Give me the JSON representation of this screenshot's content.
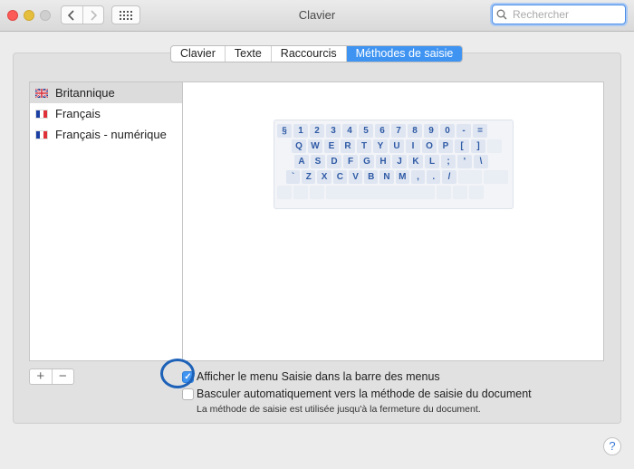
{
  "window": {
    "title": "Clavier",
    "search_placeholder": "Rechercher"
  },
  "tabs": [
    {
      "label": "Clavier",
      "active": false
    },
    {
      "label": "Texte",
      "active": false
    },
    {
      "label": "Raccourcis",
      "active": false
    },
    {
      "label": "Méthodes de saisie",
      "active": true
    }
  ],
  "input_sources": [
    {
      "label": "Britannique",
      "flag": "gb-flag-icon",
      "selected": true
    },
    {
      "label": "Français",
      "flag": "fr-flag-icon",
      "selected": false
    },
    {
      "label": "Français - numérique",
      "flag": "fr-flag-icon",
      "selected": false
    }
  ],
  "keyboard": {
    "rows": [
      [
        "§",
        "1",
        "2",
        "3",
        "4",
        "5",
        "6",
        "7",
        "8",
        "9",
        "0",
        "-",
        "="
      ],
      [
        "Q",
        "W",
        "E",
        "R",
        "T",
        "Y",
        "U",
        "I",
        "O",
        "P",
        "[",
        "]"
      ],
      [
        "A",
        "S",
        "D",
        "F",
        "G",
        "H",
        "J",
        "K",
        "L",
        ";",
        "'",
        "\\"
      ],
      [
        "`",
        "Z",
        "X",
        "C",
        "V",
        "B",
        "N",
        "M",
        ",",
        ".",
        "/"
      ]
    ]
  },
  "list_buttons": {
    "add": "+",
    "remove": "−"
  },
  "options": {
    "show_menu": {
      "label": "Afficher le menu Saisie dans la barre des menus",
      "checked": true
    },
    "auto_switch": {
      "label": "Basculer automatiquement vers la méthode de saisie du document",
      "checked": false
    },
    "note": "La méthode de saisie est utilisée jusqu'à la fermeture du document."
  },
  "help_label": "?",
  "colors": {
    "accent": "#3f94f2",
    "highlight_circle": "#1e62b8"
  }
}
